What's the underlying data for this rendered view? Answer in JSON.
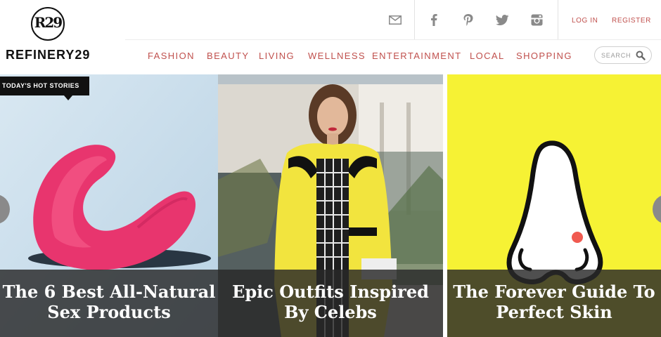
{
  "brand": {
    "logo_mark": "R29",
    "name": "REFINERY29"
  },
  "social": {
    "icons": [
      "mail-icon",
      "facebook-icon",
      "pinterest-icon",
      "twitter-icon",
      "instagram-icon"
    ]
  },
  "auth": {
    "login": "LOG IN",
    "register": "REGISTER"
  },
  "nav": {
    "items": [
      "FASHION",
      "BEAUTY",
      "LIVING",
      "WELLNESS",
      "ENTERTAINMENT",
      "LOCAL",
      "SHOPPING"
    ]
  },
  "search": {
    "placeholder": "SEARCH"
  },
  "hero": {
    "badge": "TODAY'S HOT STORIES",
    "stories": [
      {
        "line1": "The 6 Best All-Natural",
        "line2": "Sex Products"
      },
      {
        "line1": "Epic Outfits Inspired",
        "line2": "By Celebs"
      },
      {
        "line1": "The Forever Guide To",
        "line2": "Perfect Skin"
      }
    ]
  },
  "colors": {
    "accent": "#c0504d",
    "panel_yellow": "#f6f234",
    "panel_blue": "#cfe2ef",
    "caption_bg": "#2b2b2b"
  }
}
